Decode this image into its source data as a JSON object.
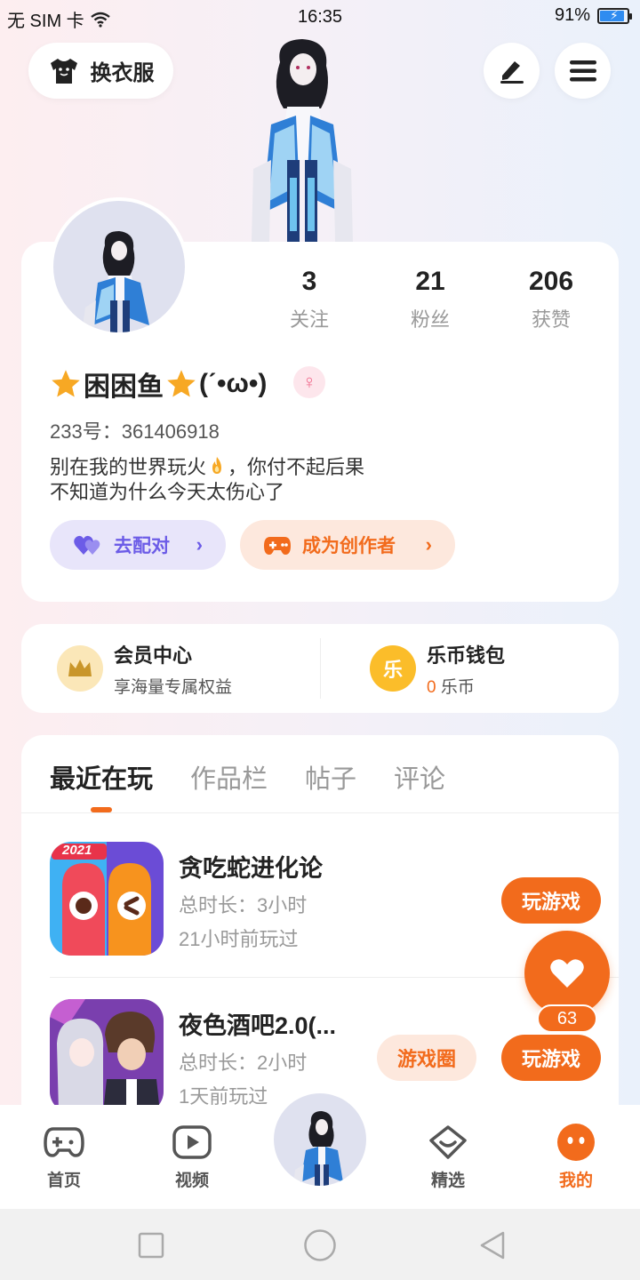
{
  "status_bar": {
    "carrier": "无 SIM 卡",
    "time": "16:35",
    "battery_text": "91%",
    "battery_level": 0.91
  },
  "header": {
    "outfit_label": "换衣服"
  },
  "profile": {
    "stats": [
      {
        "value": "3",
        "label": "关注"
      },
      {
        "value": "21",
        "label": "粉丝"
      },
      {
        "value": "206",
        "label": "获赞"
      }
    ],
    "nickname": "困困鱼",
    "nickname_suffix": "(ˊ•ω•)",
    "gender": "female",
    "uid_label": "233号：",
    "uid": "361406918",
    "bio_line1_a": "别在我的世界玩火",
    "bio_line1_b": "，你付不起后果",
    "bio_line2": "不知道为什么今天太伤心了",
    "match_label": "去配对",
    "creator_label": "成为创作者"
  },
  "vip": {
    "title": "会员中心",
    "subtitle": "享海量专属权益",
    "wallet_title": "乐币钱包",
    "wallet_icon_text": "乐",
    "wallet_amount": "0",
    "wallet_unit": " 乐币"
  },
  "tabs": [
    {
      "label": "最近在玩",
      "active": true
    },
    {
      "label": "作品栏",
      "active": false
    },
    {
      "label": "帖子",
      "active": false
    },
    {
      "label": "评论",
      "active": false
    }
  ],
  "games": [
    {
      "name": "贪吃蛇进化论",
      "duration": "总时长：3小时",
      "last_played": "21小时前玩过",
      "play_label": "玩游戏",
      "badge": "2021"
    },
    {
      "name": "夜色酒吧2.0(...",
      "duration": "总时长：2小时",
      "last_played": "1天前玩过",
      "play_label": "玩游戏",
      "circle_label": "游戏圈"
    }
  ],
  "like": {
    "count": "63"
  },
  "bottom_nav": [
    {
      "label": "首页",
      "icon": "gamepad-icon"
    },
    {
      "label": "视频",
      "icon": "play-icon"
    },
    {
      "label": "精选",
      "icon": "heart-box-icon"
    },
    {
      "label": "我的",
      "icon": "face-icon",
      "active": true
    }
  ],
  "colors": {
    "accent": "#f26b1c",
    "purple": "#6c5ce7",
    "gender_pink": "#f06c8e"
  }
}
